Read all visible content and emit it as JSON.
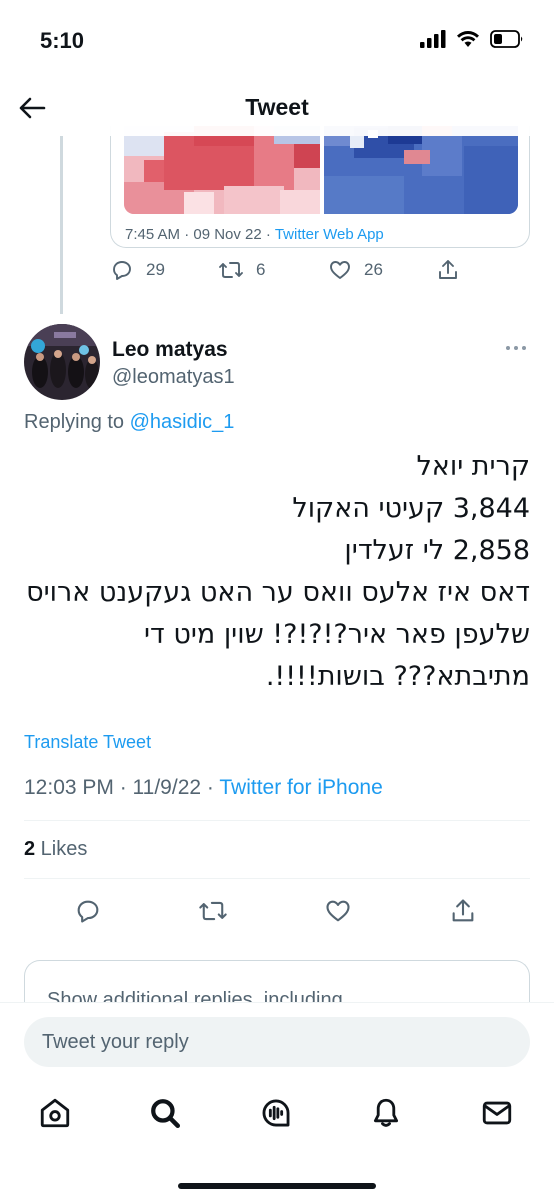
{
  "status_bar": {
    "time": "5:10"
  },
  "header": {
    "title": "Tweet"
  },
  "quoted_tweet": {
    "time": "7:45 AM · 09 Nov 22",
    "separator": " · ",
    "source": "Twitter Web App",
    "reply_count": "29",
    "retweet_count": "6",
    "like_count": "26"
  },
  "tweet": {
    "author_name": "Leo matyas",
    "author_handle": "@leomatyas1",
    "replying_prefix": "Replying to ",
    "replying_to": "@hasidic_1",
    "text_lines": [
      "קרית יואל",
      "3,844 קעיטי האקול",
      "2,858 לי זעלדין",
      "דאס איז אלעס וואס ער האט געקענט ארויס",
      "שלעפן פאר איר?!?!?!   שוין מיט די",
      "מתיבתא??? בושות!!!!."
    ],
    "translate_label": "Translate Tweet",
    "timestamp": "12:03 PM · 11/9/22",
    "separator": " · ",
    "source": "Twitter for iPhone",
    "likes_count": "2",
    "likes_label": " Likes"
  },
  "more_replies_text": "Show additional replies, including",
  "composer": {
    "placeholder": "Tweet your reply"
  },
  "colors": {
    "accent": "#1d9bf0",
    "secondary_text": "#536471",
    "divider": "#eff3f4"
  },
  "icons": {
    "tabbar": [
      "home-icon",
      "search-icon",
      "spaces-icon",
      "notifications-icon",
      "messages-icon"
    ],
    "actions": [
      "reply-icon",
      "retweet-icon",
      "like-icon",
      "share-icon"
    ]
  }
}
